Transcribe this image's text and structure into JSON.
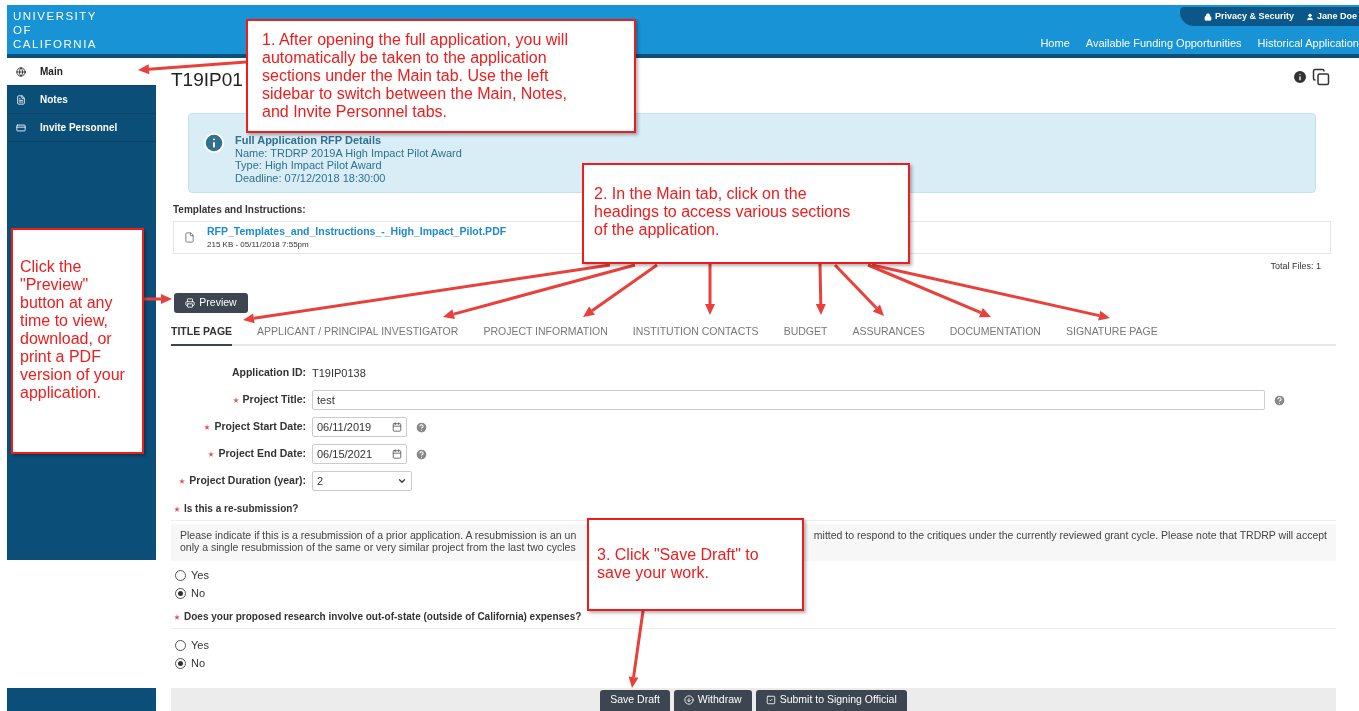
{
  "header": {
    "logo": [
      "UNIVERSITY",
      "OF",
      "CALIFORNIA"
    ],
    "utility_links": [
      {
        "kind": "lock",
        "label": "Privacy & Security"
      },
      {
        "kind": "user",
        "label": "Jane Doe"
      }
    ],
    "nav": [
      "Home",
      "Available Funding Opportunities",
      "Historical Application"
    ]
  },
  "sidebar": {
    "items": [
      {
        "kind": "globe",
        "label": "Main",
        "selected": true
      },
      {
        "kind": "notes",
        "label": "Notes",
        "selected": false
      },
      {
        "kind": "card",
        "label": "Invite Personnel",
        "selected": false
      }
    ]
  },
  "page_title": "T19IP01",
  "rfp_details": {
    "heading": "Full Application RFP Details",
    "lines": [
      "Name: TRDRP 2019A High Impact Pilot Award",
      "Type: High Impact Pilot Award",
      "Deadline: 07/12/2018 18:30:00"
    ]
  },
  "templates": {
    "label": "Templates and Instructions:",
    "files": [
      {
        "name": "RFP_Templates_and_Instructions_-_High_Impact_Pilot.PDF",
        "meta": "215 KB - 05/11/2018 7:55pm"
      }
    ],
    "total": "Total Files: 1"
  },
  "preview_button": "Preview",
  "tabs": [
    {
      "label": "TITLE PAGE",
      "selected": true
    },
    {
      "label": "APPLICANT / PRINCIPAL INVESTIGATOR",
      "selected": false
    },
    {
      "label": "PROJECT INFORMATION",
      "selected": false
    },
    {
      "label": "INSTITUTION CONTACTS",
      "selected": false
    },
    {
      "label": "BUDGET",
      "selected": false
    },
    {
      "label": "ASSURANCES",
      "selected": false
    },
    {
      "label": "DOCUMENTATION",
      "selected": false
    },
    {
      "label": "SIGNATURE PAGE",
      "selected": false
    }
  ],
  "form": {
    "fields": [
      {
        "kind": "static",
        "label": "Application ID:",
        "required": false,
        "value": "T19IP0138",
        "help": false
      },
      {
        "kind": "text",
        "label": "Project Title:",
        "required": true,
        "value": "test",
        "help": true
      },
      {
        "kind": "date",
        "label": "Project Start Date:",
        "required": true,
        "value": "06/11/2019",
        "help": true
      },
      {
        "kind": "date",
        "label": "Project End Date:",
        "required": true,
        "value": "06/15/2021",
        "help": true
      },
      {
        "kind": "select",
        "label": "Project Duration (year):",
        "required": true,
        "value": "2",
        "help": false
      }
    ]
  },
  "questions": [
    {
      "label": "Is this a re-submission?",
      "required": true,
      "note": {
        "line_1_left": "Please indicate if this is a resubmission of a prior application. A resubmission is an un",
        "line_1_right": "mitted to respond to the critiques under the currently reviewed grant cycle. Please note that TRDRP will accept",
        "line_2": "only a single resubmission of the same or very similar project from the last two cycles"
      },
      "options": [
        {
          "label": "Yes",
          "selected": false
        },
        {
          "label": "No",
          "selected": true
        }
      ]
    },
    {
      "label": "Does your proposed research involve out-of-state (outside of California) expenses?",
      "required": true,
      "options": [
        {
          "label": "Yes",
          "selected": false
        },
        {
          "label": "No",
          "selected": true
        }
      ]
    }
  ],
  "footer_buttons": [
    {
      "kind": "plain",
      "label": "Save Draft"
    },
    {
      "kind": "withdraw",
      "label": "Withdraw"
    },
    {
      "kind": "submit",
      "label": "Submit to Signing Official"
    }
  ],
  "callouts": [
    "1. After opening the full application, you will automatically be taken to the application sections under the Main tab. Use the left sidebar to switch between the Main, Notes, and Invite Personnel tabs.",
    "2. In the Main tab, click on the headings to access various sections of the application.",
    "3. Click \"Save Draft\" to save your work.",
    "Click the \"Preview\" button at any time to view, download, or print a PDF version of your application."
  ]
}
